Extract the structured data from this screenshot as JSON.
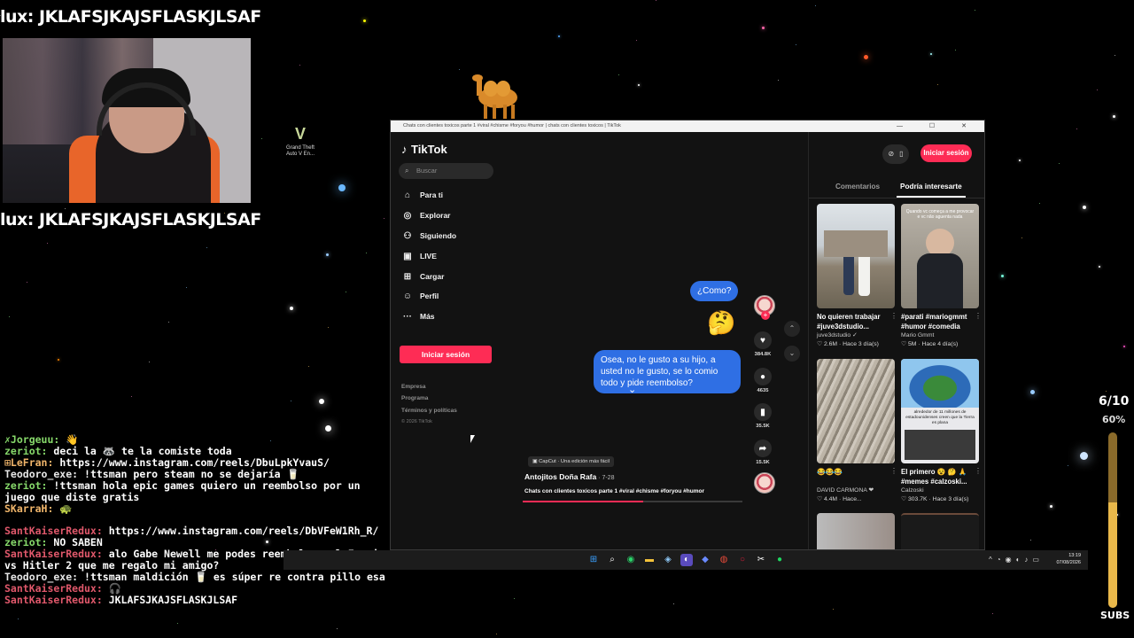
{
  "overlay": {
    "banner_top": "lux: JKLAFSJKAJSFLASKJLSAF",
    "banner_mid": "lux: JKLAFSJKAJSFLASKJLSAF"
  },
  "chat": [
    {
      "user": "✗Jorgeuu:",
      "text": " 👋",
      "color": "green"
    },
    {
      "user": "zeriot:",
      "text": " deci la 🦝 te la comiste toda",
      "color": "green"
    },
    {
      "user": "⊞LeFran:",
      "text": " https://www.instagram.com/reels/DbuLpkYvauS/",
      "color": "orange"
    },
    {
      "user": "Teodoro_exe:",
      "text": " !ttsman pero steam no se dejaría 🥛",
      "color": "white"
    },
    {
      "user": "zeriot:",
      "text": " !ttsman hola epic games quiero un reembolso por un juego que diste gratis",
      "color": "green"
    },
    {
      "user": "SKarraH:",
      "text": " 🐢",
      "color": "orange"
    },
    {
      "user": "SantKaiserRedux:",
      "text": " https://www.instagram.com/reels/DbVFeW1Rh_R/",
      "color": "red",
      "gap": true
    },
    {
      "user": "zeriot:",
      "text": " NO SABEN",
      "color": "green"
    },
    {
      "user": "SantKaiserRedux:",
      "text": " alo Gabe Newell me podes reembolsar el Furries vs Hitler 2 que me regalo mi amigo?",
      "color": "red"
    },
    {
      "user": "Teodoro_exe:",
      "text": " !ttsman maldición 🥛 es súper re contra pillo esa",
      "color": "white"
    },
    {
      "user": "SantKaiserRedux:",
      "text": " 🎧",
      "color": "red"
    },
    {
      "user": "SantKaiserRedux:",
      "text": " JKLAFSJKAJSFLASKJLSAF",
      "color": "red"
    }
  ],
  "desktop": {
    "icon_label": "Grand Theft Auto V En..."
  },
  "window": {
    "title": "Chats con clientes toxicos parte 1 #viral #chisme #foryou #humor | chats con clientes toxicos | TikTok",
    "controls": "— ☐ ✕"
  },
  "tiktok": {
    "logo": "TikTok",
    "search_placeholder": "Buscar",
    "nav": [
      {
        "label": "Para ti",
        "icon": "home-icon"
      },
      {
        "label": "Explorar",
        "icon": "compass-icon"
      },
      {
        "label": "Siguiendo",
        "icon": "following-icon"
      },
      {
        "label": "LIVE",
        "icon": "live-icon"
      },
      {
        "label": "Cargar",
        "icon": "upload-icon"
      },
      {
        "label": "Perfil",
        "icon": "profile-icon"
      },
      {
        "label": "Más",
        "icon": "more-icon"
      }
    ],
    "login": "Iniciar sesión",
    "footer": [
      "Empresa",
      "Programa",
      "Términos y políticas"
    ],
    "copyright": "© 2026 TikTok",
    "video": {
      "bubble1": "¿Como?",
      "bubble2": "Osea, no le gusto a su hijo, a usted no le gusto, se lo comio todo y pide reembolso?",
      "capcut": "CapCut · Una edición más fácil",
      "author": "Antojitos Doña Rafa",
      "date": " · 7-28",
      "description": "Chats con clientes toxicos parte 1 #viral #chisme #foryou #humor",
      "progress": 0.55
    },
    "actions": {
      "likes": "384.8K",
      "comments": "4635",
      "saves": "35.5K",
      "shares": "15.5K"
    },
    "right": {
      "login": "Iniciar sesión",
      "tab_comments": "Comentarios",
      "tab_interesting": "Podría interesarte",
      "cards": [
        {
          "title": "No quieren trabajar #juve3dstudio...",
          "author": "juve3dstudio ✓",
          "stats": "♡ 2.6M · Hace 3 día(s)"
        },
        {
          "title": "#parati #mariogmmt #humor #comedia",
          "author": "Mario Gmmt",
          "stats": "♡ 5M · Hace 4 día(s)"
        },
        {
          "title": "😂😂😂",
          "author": "DAVID CARMONA ❤",
          "stats": "♡ 4.4M · Hace..."
        },
        {
          "title": "El primero 😵 🤔 🙏 #memes #calzoski...",
          "author": "Calzoski",
          "stats": "♡ 303.7K · Hace 3 día(s)"
        }
      ],
      "thumb2_caption": "Quando vc começa a me provocar e vc não aguenta nada",
      "thumb4_caption": "alrededor de 11 millones de estadounidenses creen que la Tierra es plana"
    }
  },
  "taskbar": {
    "time": "13:19",
    "date": "07/08/2026"
  },
  "widgets": {
    "counter": "6/10",
    "percent": "60%",
    "subs_label": "SUBS",
    "subs_fill": 0.6
  }
}
